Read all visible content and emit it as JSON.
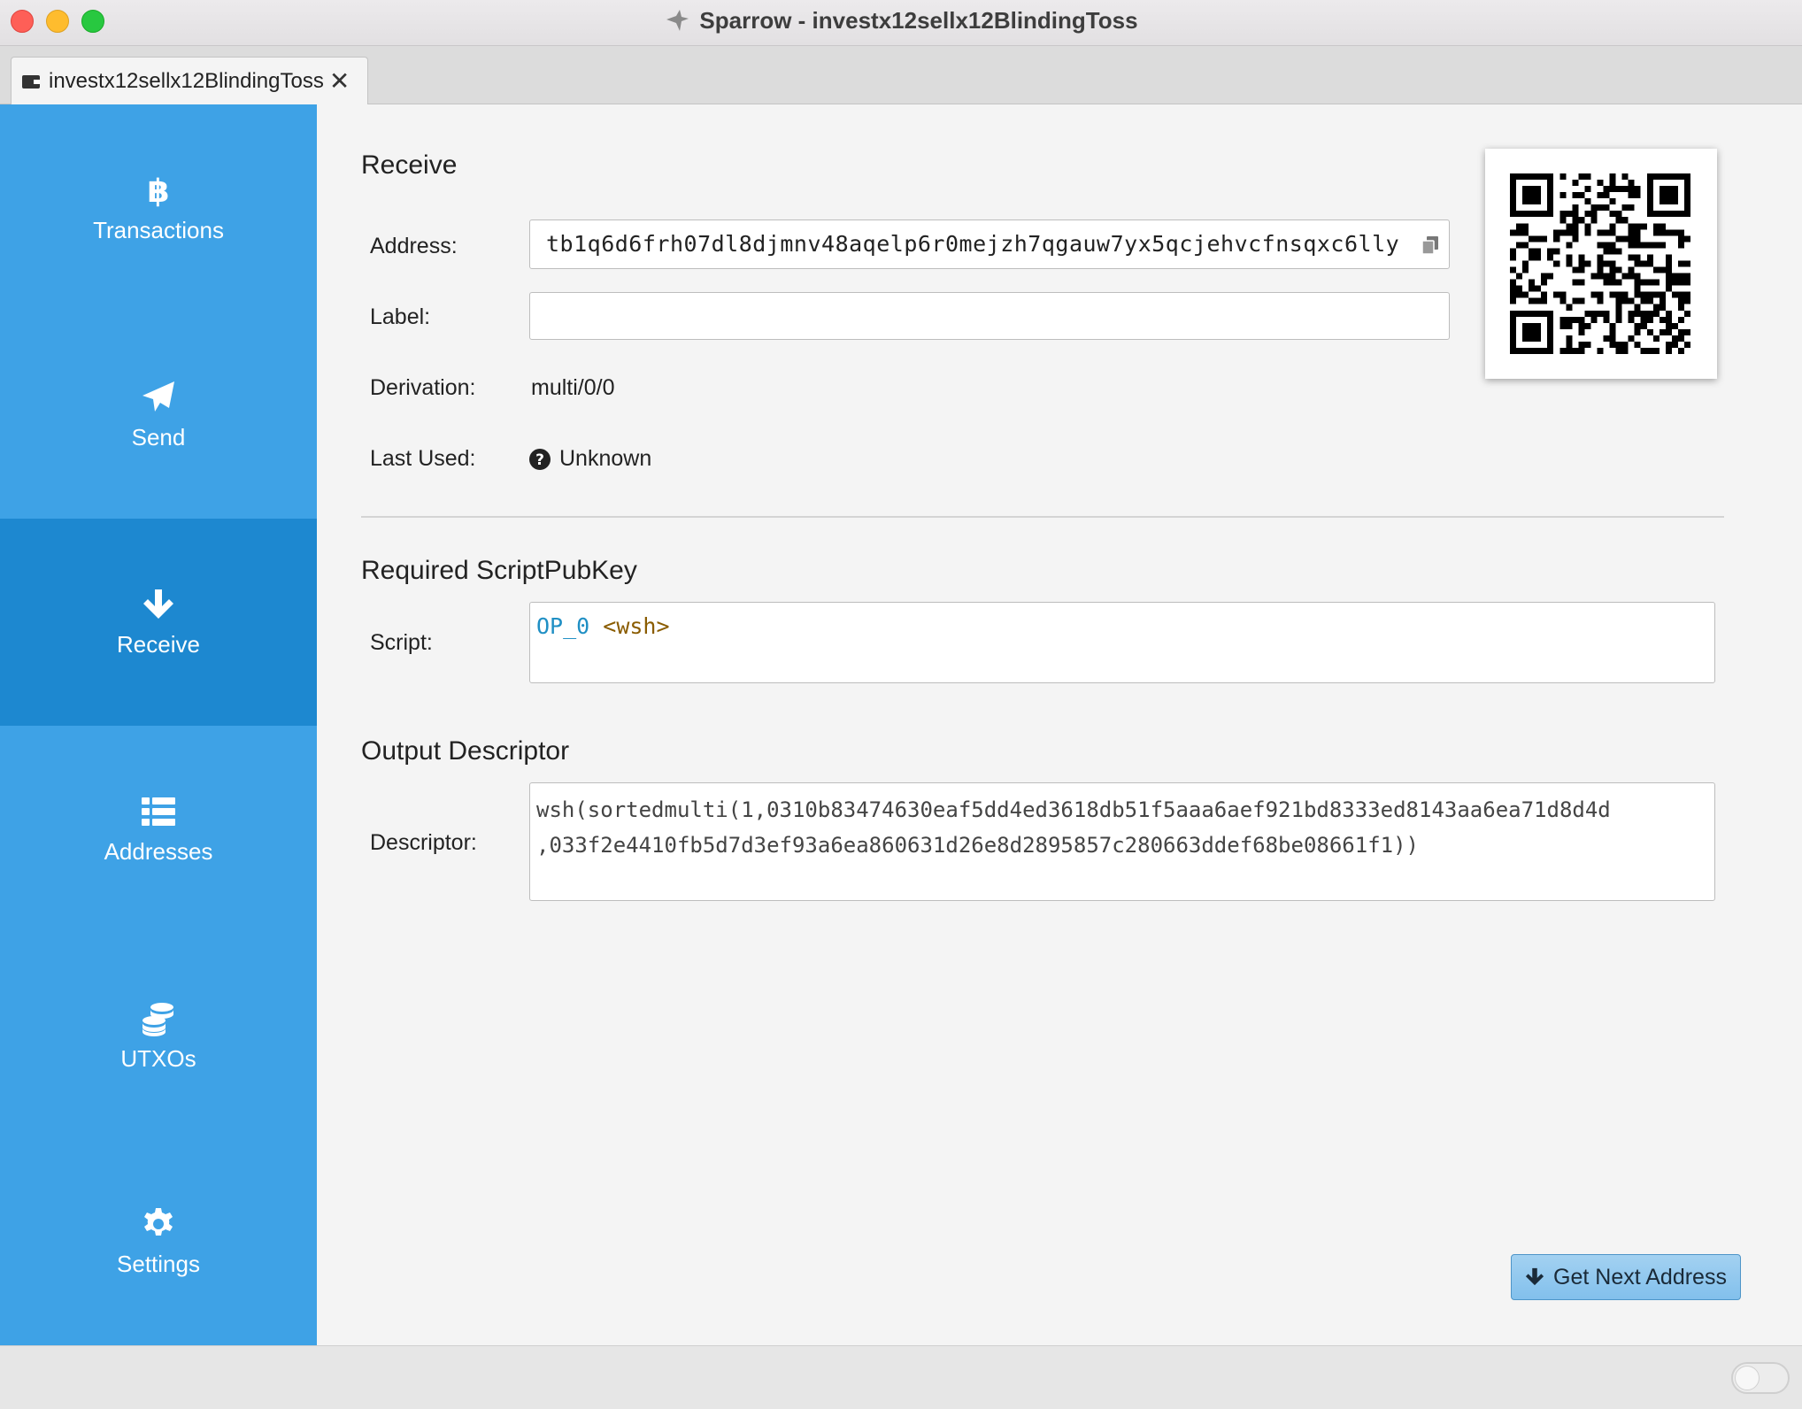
{
  "window": {
    "title": "Sparrow - investx12sellx12BlindingToss"
  },
  "tabs": [
    {
      "label": "investx12sellx12BlindingToss",
      "close_symbol": "✕"
    }
  ],
  "sidebar": {
    "items": [
      {
        "label": "Transactions",
        "icon": "bitcoin-icon",
        "active": false
      },
      {
        "label": "Send",
        "icon": "paper-plane-icon",
        "active": false
      },
      {
        "label": "Receive",
        "icon": "arrow-down-icon",
        "active": true
      },
      {
        "label": "Addresses",
        "icon": "list-icon",
        "active": false
      },
      {
        "label": "UTXOs",
        "icon": "coins-icon",
        "active": false
      },
      {
        "label": "Settings",
        "icon": "gear-icon",
        "active": false
      }
    ]
  },
  "receive": {
    "title": "Receive",
    "address_label": "Address:",
    "address_value": "tb1q6d6frh07dl8djmnv48aqelp6r0mejzh7qgauw7yx5qcjehvcfnsqxc6lly",
    "label_label": "Label:",
    "label_value": "",
    "derivation_label": "Derivation:",
    "derivation_value": "multi/0/0",
    "last_used_label": "Last Used:",
    "last_used_value": "Unknown"
  },
  "scriptpubkey": {
    "title": "Required ScriptPubKey",
    "script_label": "Script:",
    "script_op": "OP_0",
    "script_arg": "<wsh>"
  },
  "descriptor": {
    "title": "Output Descriptor",
    "descriptor_label": "Descriptor:",
    "line1": "wsh(sortedmulti(1,0310b83474630eaf5dd4ed3618db51f5aaa6aef921bd8333ed8143aa6ea71d8d4d",
    "line2": ",033f2e4410fb5d7d3ef93a6ea860631d26e8d2895857c280663ddef68be08661f1))"
  },
  "actions": {
    "get_next_address": "Get Next Address"
  },
  "colors": {
    "sidebar": "#3ea2e6",
    "sidebar_active": "#1d88d0",
    "script_op": "#1f8fc4",
    "script_arg": "#8a5c00"
  }
}
